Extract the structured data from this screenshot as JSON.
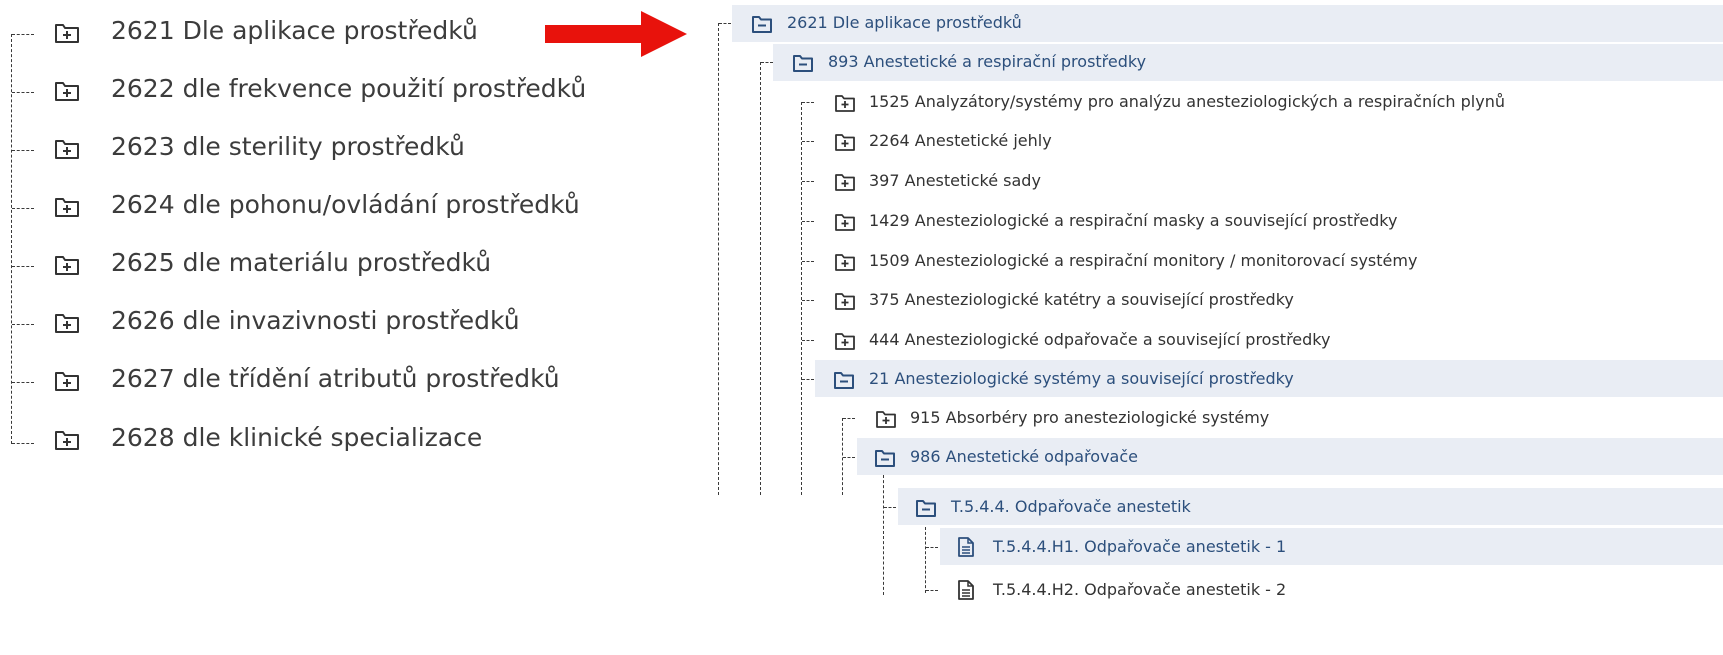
{
  "left_tree": {
    "items": [
      {
        "label": "2621 Dle aplikace prostředků"
      },
      {
        "label": "2622 dle frekvence použití prostředků"
      },
      {
        "label": "2623 dle sterility prostředků"
      },
      {
        "label": "2624 dle pohonu/ovládání prostředků"
      },
      {
        "label": "2625 dle materiálu prostředků"
      },
      {
        "label": "2626 dle invazivnosti prostředků"
      },
      {
        "label": "2627 dle třídění atributů prostředků"
      },
      {
        "label": "2628 dle klinické specializace"
      }
    ]
  },
  "arrow": {
    "color": "#e8120c",
    "icon": "arrow-right-icon"
  },
  "right_tree": {
    "root": {
      "label": "2621 Dle aplikace prostředků",
      "state": "expanded"
    },
    "level1": {
      "label": "893 Anestetické a respirační prostředky",
      "state": "expanded"
    },
    "level2": [
      {
        "label": "1525 Analyzátory/systémy pro analýzu anesteziologických a respiračních plynů",
        "state": "collapsed"
      },
      {
        "label": "2264 Anestetické jehly",
        "state": "collapsed"
      },
      {
        "label": "397 Anestetické sady",
        "state": "collapsed"
      },
      {
        "label": "1429 Anesteziologické a respirační masky a související prostředky",
        "state": "collapsed"
      },
      {
        "label": "1509 Anesteziologické a respirační monitory / monitorovací systémy",
        "state": "collapsed"
      },
      {
        "label": "375 Anesteziologické katétry a související prostředky",
        "state": "collapsed"
      },
      {
        "label": "444 Anesteziologické odpařovače a související prostředky",
        "state": "collapsed"
      },
      {
        "label": "21 Anesteziologické systémy a související prostředky",
        "state": "expanded"
      }
    ],
    "level3": [
      {
        "label": "915 Absorbéry pro anesteziologické systémy",
        "state": "collapsed"
      },
      {
        "label": "986 Anestetické odpařovače",
        "state": "expanded"
      }
    ],
    "level4": {
      "label": "T.5.4.4. Odpařovače anestetik",
      "state": "expanded"
    },
    "level5": [
      {
        "label": "T.5.4.4.H1. Odpařovače anestetik - 1",
        "state": "selected"
      },
      {
        "label": "T.5.4.4.H2. Odpařovače anestetik - 2",
        "state": "leaf"
      }
    ]
  },
  "colors": {
    "highlight": "#e9edf4",
    "link_blue": "#2c4f7c",
    "arrow_red": "#e8120c"
  }
}
